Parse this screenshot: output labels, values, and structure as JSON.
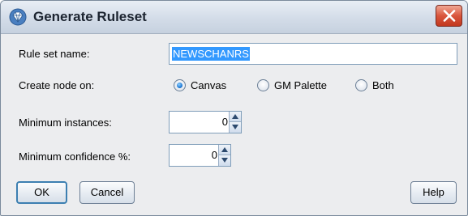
{
  "dialog": {
    "title": "Generate Ruleset"
  },
  "form": {
    "rule_set_name_label": "Rule set name:",
    "rule_set_name_value": "NEWSCHANRS",
    "create_node_label": "Create node on:",
    "create_node_options": [
      {
        "label": "Canvas",
        "selected": true
      },
      {
        "label": "GM Palette",
        "selected": false
      },
      {
        "label": "Both",
        "selected": false
      }
    ],
    "min_instances_label": "Minimum instances:",
    "min_instances_value": "0",
    "min_confidence_label": "Minimum confidence %:",
    "min_confidence_value": "0"
  },
  "buttons": {
    "ok": "OK",
    "cancel": "Cancel",
    "help": "Help"
  },
  "colors": {
    "selection": "#3399ff",
    "close_button": "#d9563d",
    "radio_selected": "#1f7ad6"
  },
  "icons": {
    "title": "diamond-gem-icon",
    "close": "close-x-icon",
    "spin_up": "spin-up-icon",
    "spin_down": "spin-down-icon"
  }
}
